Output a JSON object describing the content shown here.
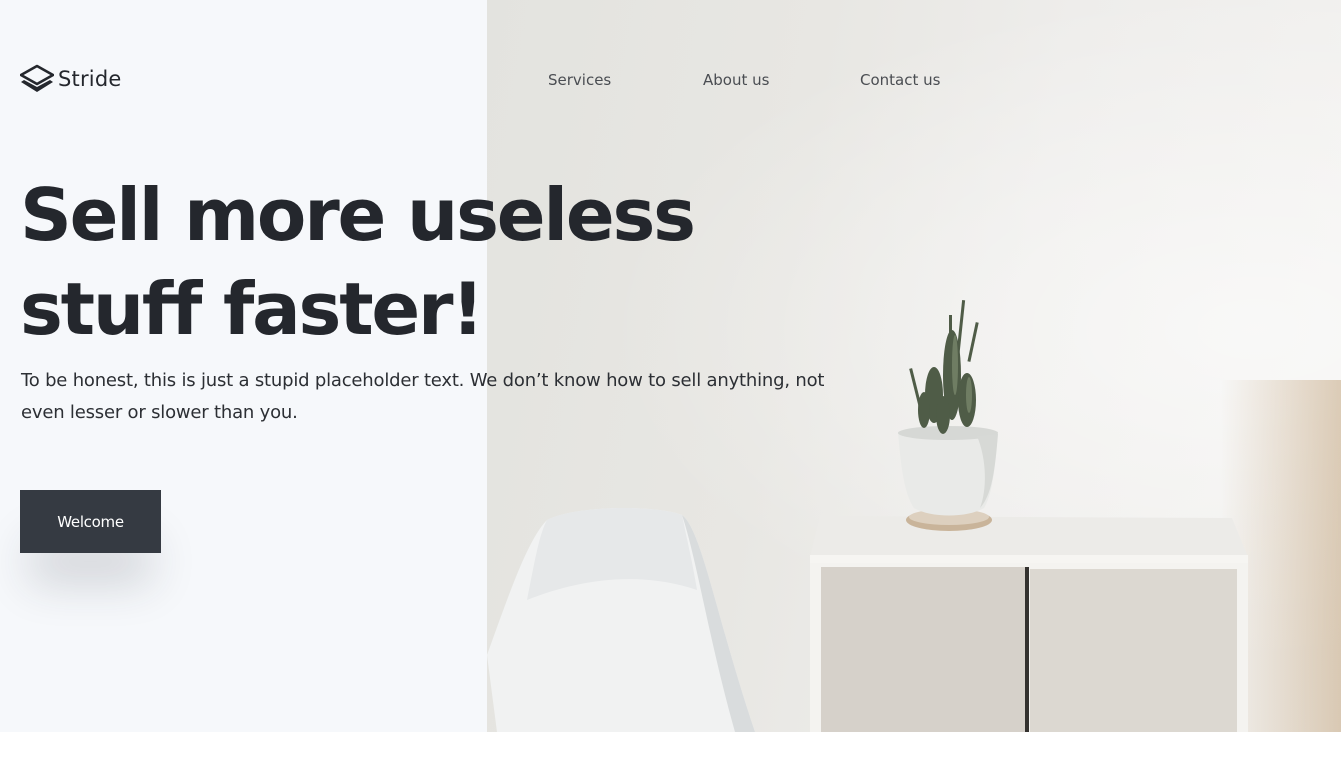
{
  "brand": {
    "name": "Stride",
    "icon": "stack-icon"
  },
  "nav": {
    "items": [
      "Services",
      "About us",
      "Contact us"
    ]
  },
  "hero": {
    "headline": "Sell more useless stuff faster!",
    "subtext": "To be honest, this is just a stupid placeholder text. We don’t know how to sell anything, not even lesser or slower than you.",
    "cta_label": "Welcome"
  },
  "colors": {
    "background": "#f6f8fb",
    "text": "#24272d",
    "button": "#353a42"
  }
}
